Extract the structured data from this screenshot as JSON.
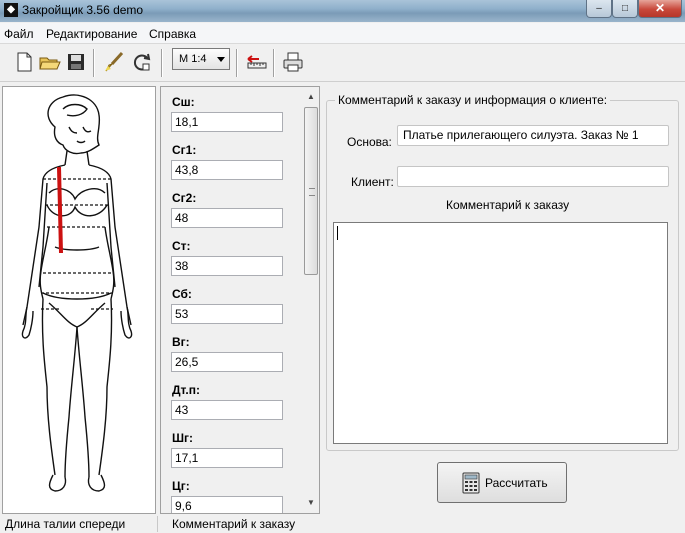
{
  "window": {
    "title": "Закройщик 3.56 demo",
    "icon": "app-logo-icon",
    "controls": {
      "minimize": "–",
      "maximize": "□",
      "close": "✕"
    }
  },
  "menu": [
    "Файл",
    "Редактирование",
    "Справка"
  ],
  "toolbar": {
    "buttons": [
      "new-file-icon",
      "open-folder-icon",
      "save-icon",
      "brush-icon",
      "refresh-icon",
      "ruler-icon",
      "print-icon"
    ],
    "scale": "M 1:4"
  },
  "measurements": [
    {
      "label": "Сш:",
      "value": "18,1"
    },
    {
      "label": "Сг1:",
      "value": "43,8"
    },
    {
      "label": "Сг2:",
      "value": "48"
    },
    {
      "label": "Ст:",
      "value": "38"
    },
    {
      "label": "Сб:",
      "value": "53"
    },
    {
      "label": "Вг:",
      "value": "26,5"
    },
    {
      "label": "Дт.п:",
      "value": "43"
    },
    {
      "label": "Шг:",
      "value": "17,1"
    },
    {
      "label": "Цг:",
      "value": "9,6"
    }
  ],
  "info": {
    "legend": "Комментарий к заказу и информация о клиенте:",
    "basis_label": "Основа:",
    "basis_value": "Платье прилегающего силуэта. Заказ № 1",
    "client_label": "Клиент:",
    "client_value": "",
    "comment_title": "Комментарий к заказу",
    "comment_value": ""
  },
  "calc_button": "Рассчитать",
  "status": {
    "left": "Длина талии спереди",
    "right": "Комментарий к заказу"
  },
  "colors": {
    "highlight": "#cc1111"
  }
}
